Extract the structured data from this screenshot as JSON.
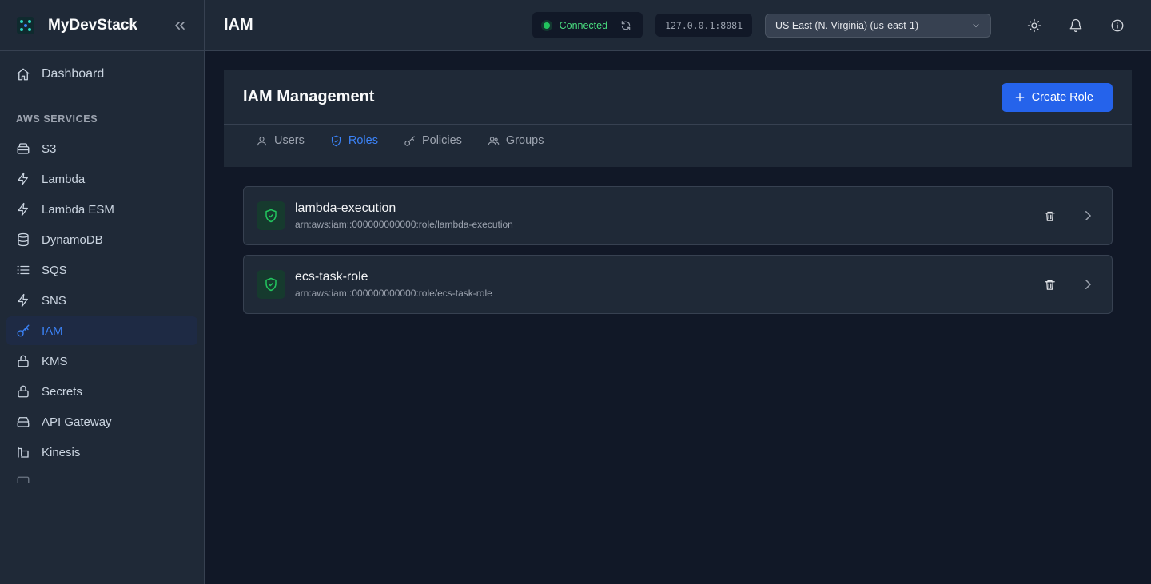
{
  "app": {
    "name": "MyDevStack"
  },
  "sidebar": {
    "dashboard": {
      "label": "Dashboard",
      "icon": "home-icon"
    },
    "section_title": "AWS SERVICES",
    "items": [
      {
        "label": "S3",
        "icon": "storage-icon",
        "active": false
      },
      {
        "label": "Lambda",
        "icon": "lightning-icon",
        "active": false
      },
      {
        "label": "Lambda ESM",
        "icon": "lightning-icon",
        "active": false
      },
      {
        "label": "DynamoDB",
        "icon": "database-icon",
        "active": false
      },
      {
        "label": "SQS",
        "icon": "list-icon",
        "active": false
      },
      {
        "label": "SNS",
        "icon": "lightning-icon",
        "active": false
      },
      {
        "label": "IAM",
        "icon": "key-icon",
        "active": true
      },
      {
        "label": "KMS",
        "icon": "lock-icon",
        "active": false
      },
      {
        "label": "Secrets",
        "icon": "lock-icon",
        "active": false
      },
      {
        "label": "API Gateway",
        "icon": "server-icon",
        "active": false
      },
      {
        "label": "Kinesis",
        "icon": "stream-icon",
        "active": false
      }
    ]
  },
  "topbar": {
    "title": "IAM",
    "connection": {
      "status": "Connected",
      "color": "#22c55e"
    },
    "endpoint": "127.0.0.1:8081",
    "region": "US East (N. Virginia) (us-east-1)"
  },
  "main": {
    "title": "IAM Management",
    "create_button": "Create Role",
    "tabs": [
      {
        "label": "Users",
        "icon": "user-icon",
        "active": false
      },
      {
        "label": "Roles",
        "icon": "shield-icon",
        "active": true
      },
      {
        "label": "Policies",
        "icon": "key-icon",
        "active": false
      },
      {
        "label": "Groups",
        "icon": "group-icon",
        "active": false
      }
    ],
    "roles": [
      {
        "name": "lambda-execution",
        "arn": "arn:aws:iam::000000000000:role/lambda-execution"
      },
      {
        "name": "ecs-task-role",
        "arn": "arn:aws:iam::000000000000:role/ecs-task-role"
      }
    ]
  },
  "colors": {
    "accent": "#2563eb",
    "active_nav": "#3b82f6",
    "success": "#22c55e",
    "background": "#111827",
    "panel": "#1f2937"
  }
}
